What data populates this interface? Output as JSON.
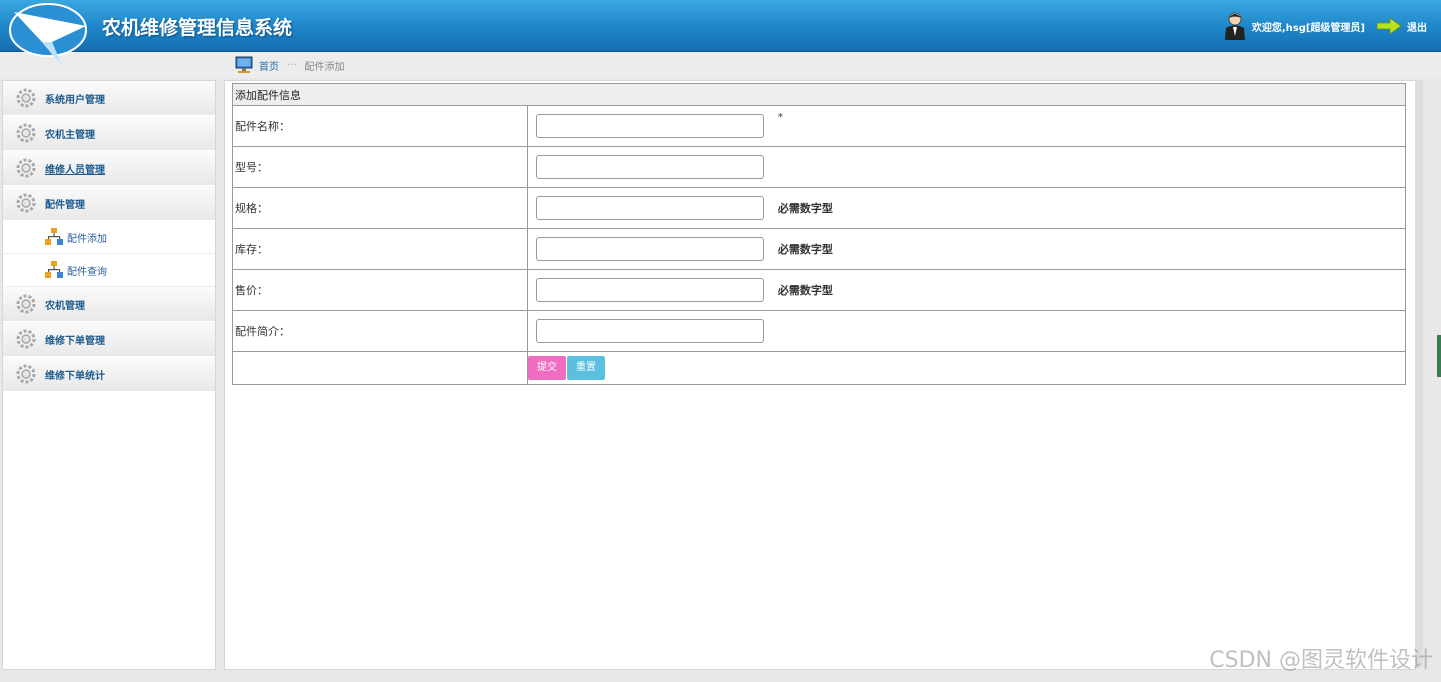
{
  "header": {
    "title": "农机维修管理信息系统",
    "welcome": "欢迎您,hsg[超级管理员]",
    "logout": "退出"
  },
  "breadcrumb": {
    "home": "首页",
    "separator": "···",
    "current": "配件添加"
  },
  "sidebar": {
    "items": [
      {
        "label": "系统用户管理"
      },
      {
        "label": "农机主管理"
      },
      {
        "label": "维修人员管理"
      },
      {
        "label": "配件管理"
      }
    ],
    "subitems": [
      {
        "label": "配件添加"
      },
      {
        "label": "配件查询"
      }
    ],
    "items_after": [
      {
        "label": "农机管理"
      },
      {
        "label": "维修下单管理"
      },
      {
        "label": "维修下单统计"
      }
    ]
  },
  "form": {
    "caption": "添加配件信息",
    "required_mark": "*",
    "fields": [
      {
        "label": "配件名称：",
        "value": "",
        "note": ""
      },
      {
        "label": "型号：",
        "value": "",
        "note": ""
      },
      {
        "label": "规格：",
        "value": "",
        "note": "必需数字型"
      },
      {
        "label": "库存：",
        "value": "",
        "note": "必需数字型"
      },
      {
        "label": "售价：",
        "value": "",
        "note": "必需数字型"
      },
      {
        "label": "配件简介：",
        "value": "",
        "note": ""
      }
    ],
    "submit": "提交",
    "reset": "重置"
  },
  "watermark": "CSDN @图灵软件设计",
  "colors": {
    "header": "#1e85c8",
    "menu_text": "#1d5b8e",
    "submit": "#ef6dc2",
    "reset": "#5bc0de"
  }
}
